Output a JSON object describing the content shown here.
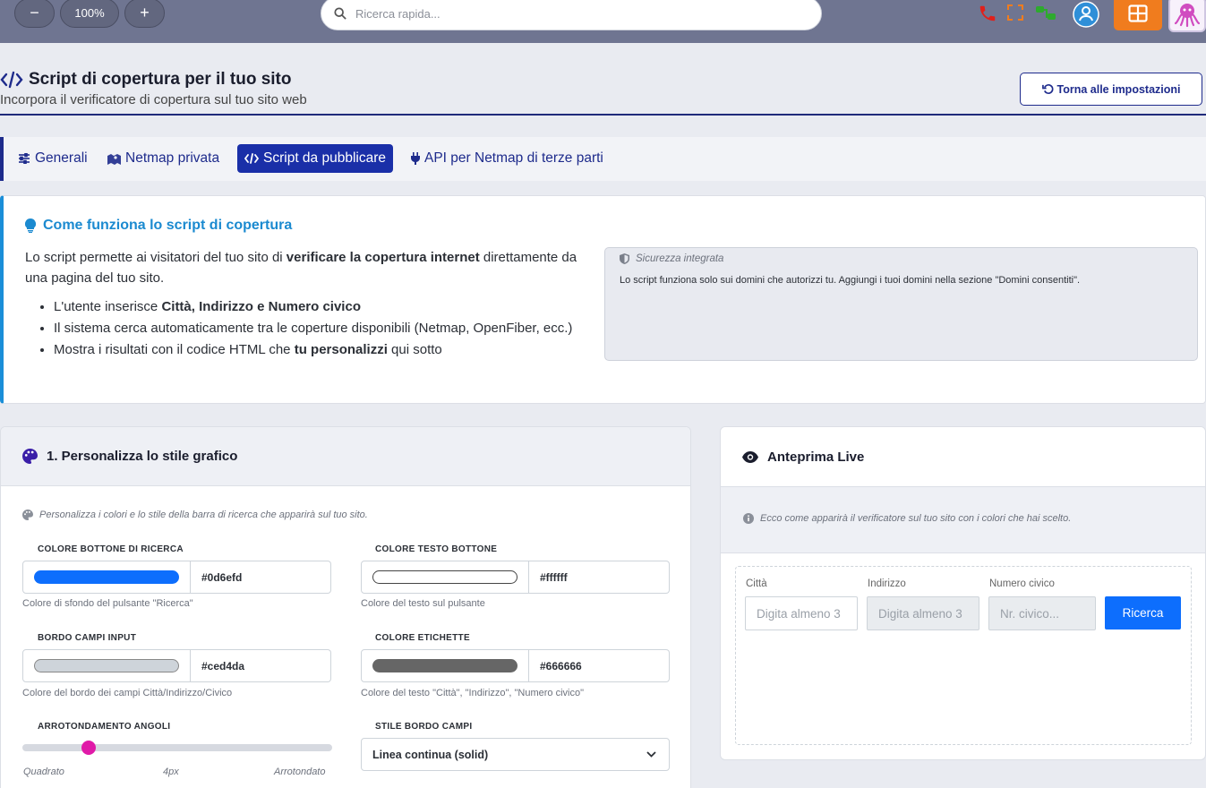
{
  "topbar": {
    "zoom_out": "−",
    "zoom_level": "100%",
    "zoom_in": "+",
    "search_placeholder": "Ricerca rapida...",
    "icons": [
      "phone-icon",
      "fullscreen-icon",
      "network-icon",
      "user-icon",
      "grid-icon",
      "octopus-logo"
    ],
    "colors": {
      "bar": "#6f7591",
      "orange": "#f07c1e",
      "phone": "#e0201b",
      "network": "#2eaa2e",
      "user": "#2f8fd8"
    }
  },
  "header": {
    "title": "Script di copertura per il tuo sito",
    "subtitle": "Incorpora il verificatore di copertura sul tuo sito web",
    "back_button": "Torna alle impostazioni"
  },
  "tabs": [
    {
      "label": "Generali",
      "icon": "sliders-icon",
      "active": false
    },
    {
      "label": "Netmap privata",
      "icon": "map-icon",
      "active": false
    },
    {
      "label": "Script da pubblicare",
      "icon": "code-icon",
      "active": true
    },
    {
      "label": "API per Netmap di terze parti",
      "icon": "plug-icon",
      "active": false
    }
  ],
  "info": {
    "title": "Come funziona lo script di copertura",
    "intro_1": "Lo script permette ai visitatori del tuo sito di ",
    "intro_bold": "verificare la copertura internet",
    "intro_2": " direttamente da una pagina del tuo sito.",
    "bullets": [
      {
        "pre": "L'utente inserisce ",
        "bold": "Città, Indirizzo e Numero civico",
        "post": ""
      },
      {
        "pre": "Il sistema cerca automaticamente tra le coperture disponibili (Netmap, OpenFiber, ecc.)",
        "bold": "",
        "post": ""
      },
      {
        "pre": "Mostra i risultati con il codice HTML che ",
        "bold": "tu personalizzi",
        "post": " qui sotto"
      }
    ],
    "security_title": "Sicurezza integrata",
    "security_text": "Lo script funziona solo sui domini che autorizzi tu. Aggiungi i tuoi domini nella sezione \"Domini consentiti\"."
  },
  "style": {
    "title": "1. Personalizza lo stile grafico",
    "hint": "Personalizza i colori e lo stile della barra di ricerca che apparirà sul tuo sito.",
    "fields": {
      "button_color": {
        "label": "COLORE BOTTONE DI RICERCA",
        "value": "#0d6efd",
        "help": "Colore di sfondo del pulsante \"Ricerca\""
      },
      "button_text_color": {
        "label": "COLORE TESTO BOTTONE",
        "value": "#ffffff",
        "help": "Colore del testo sul pulsante"
      },
      "input_border": {
        "label": "BORDO CAMPI INPUT",
        "value": "#ced4da",
        "help": "Colore del bordo dei campi Città/Indirizzo/Civico"
      },
      "label_color": {
        "label": "COLORE ETICHETTE",
        "value": "#666666",
        "help": "Colore del testo \"Città\", \"Indirizzo\", \"Numero civico\""
      }
    },
    "radius": {
      "label": "ARROTONDAMENTO ANGOLI",
      "min_label": "Quadrato",
      "value_label": "4px",
      "max_label": "Arrotondato",
      "value_fraction": 0.2
    },
    "border_style": {
      "label": "STILE BORDO CAMPI",
      "value": "Linea continua (solid)"
    }
  },
  "preview": {
    "title": "Anteprima Live",
    "hint": "Ecco come apparirà il verificatore sul tuo sito con i colori che hai scelto.",
    "city_label": "Città",
    "city_placeholder": "Digita almeno 3",
    "address_label": "Indirizzo",
    "address_placeholder": "Digita almeno 3",
    "number_label": "Numero civico",
    "number_placeholder": "Nr. civico...",
    "button": "Ricerca"
  }
}
